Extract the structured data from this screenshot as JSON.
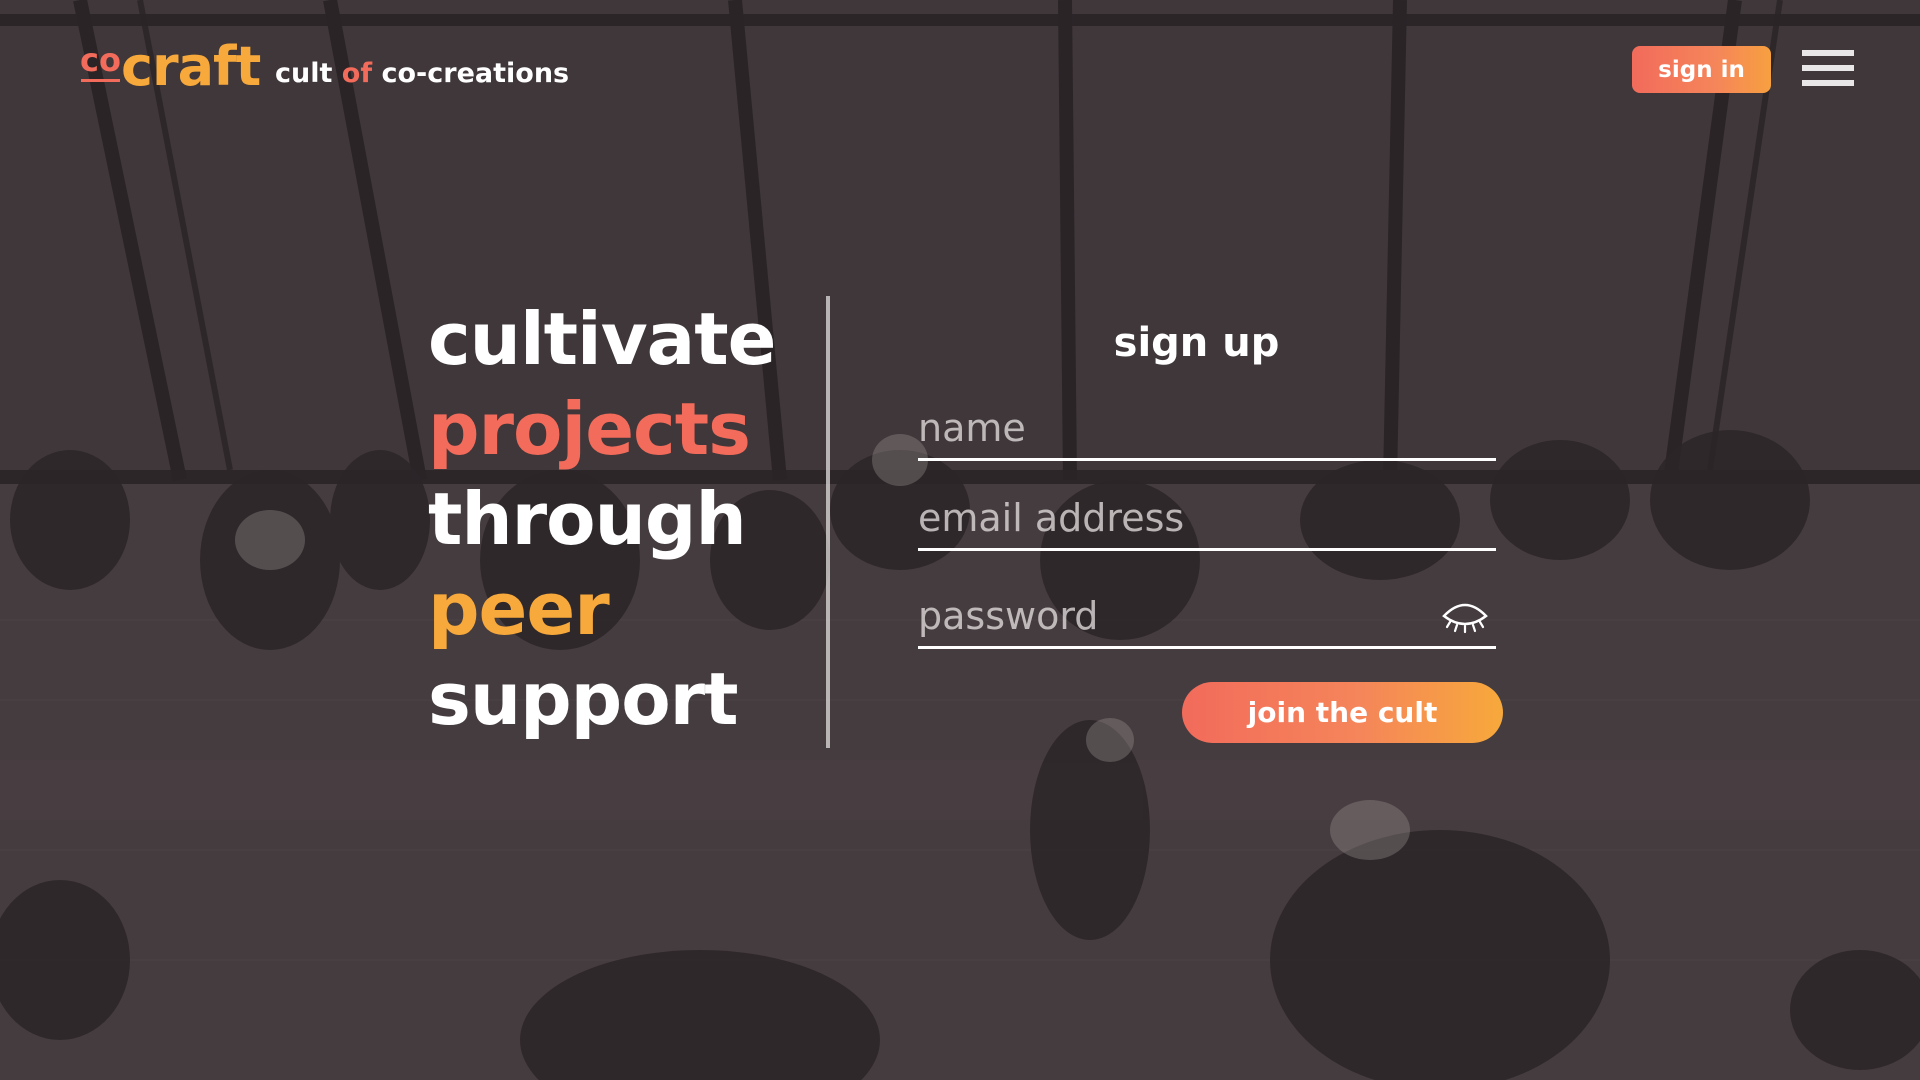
{
  "header": {
    "logo_co": "co",
    "logo_craft": "craft",
    "tagline_part1": "cult ",
    "tagline_accent": "of",
    "tagline_part2": " co-creations",
    "signin_label": "sign in",
    "menu_icon": "hamburger-menu-icon"
  },
  "hero": {
    "words": [
      "cultivate",
      "projects",
      "through",
      "peer",
      "support"
    ]
  },
  "signup": {
    "title": "sign up",
    "name_placeholder": "name",
    "email_placeholder": "email address",
    "password_placeholder": "password",
    "password_toggle_icon": "eye-closed-icon",
    "submit_label": "join the cult"
  },
  "colors": {
    "accent_red": "#f26b5b",
    "accent_yellow": "#f7a93b",
    "text": "#ffffff"
  }
}
